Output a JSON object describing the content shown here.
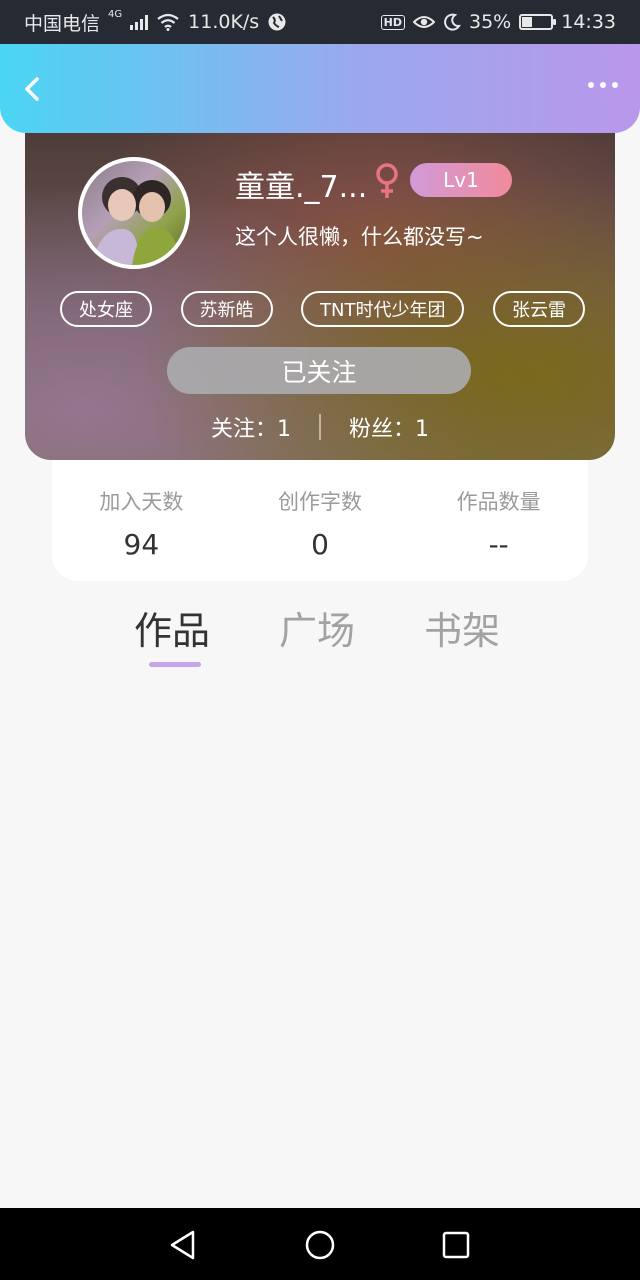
{
  "status_bar": {
    "carrier": "中国电信",
    "network": "4G",
    "speed": "11.0K/s",
    "hd": "HD",
    "battery": "35%",
    "battery_level": 0.35,
    "time": "14:33"
  },
  "header": {
    "back_icon": "chevron-left-icon",
    "more_icon": "more-dots-icon"
  },
  "profile": {
    "nickname": "童童._7...",
    "gender": "female",
    "gender_color": "#e7747e",
    "level": "Lv1",
    "bio": "这个人很懒，什么都没写~",
    "tags": [
      "处女座",
      "苏新皓",
      "TNT时代少年团",
      "张云雷"
    ],
    "follow_button": "已关注",
    "following": "关注：1",
    "fans": "粉丝：1"
  },
  "stats": [
    {
      "label": "加入天数",
      "value": "94"
    },
    {
      "label": "创作字数",
      "value": "0"
    },
    {
      "label": "作品数量",
      "value": "--"
    }
  ],
  "tabs": [
    {
      "label": "作品",
      "active": true
    },
    {
      "label": "广场",
      "active": false
    },
    {
      "label": "书架",
      "active": false
    }
  ],
  "colors": {
    "header_start": "#4ad5f4",
    "header_end": "#b997ea",
    "tab_indicator": "#c6a6e6",
    "level_badge": "#f08a9a"
  }
}
